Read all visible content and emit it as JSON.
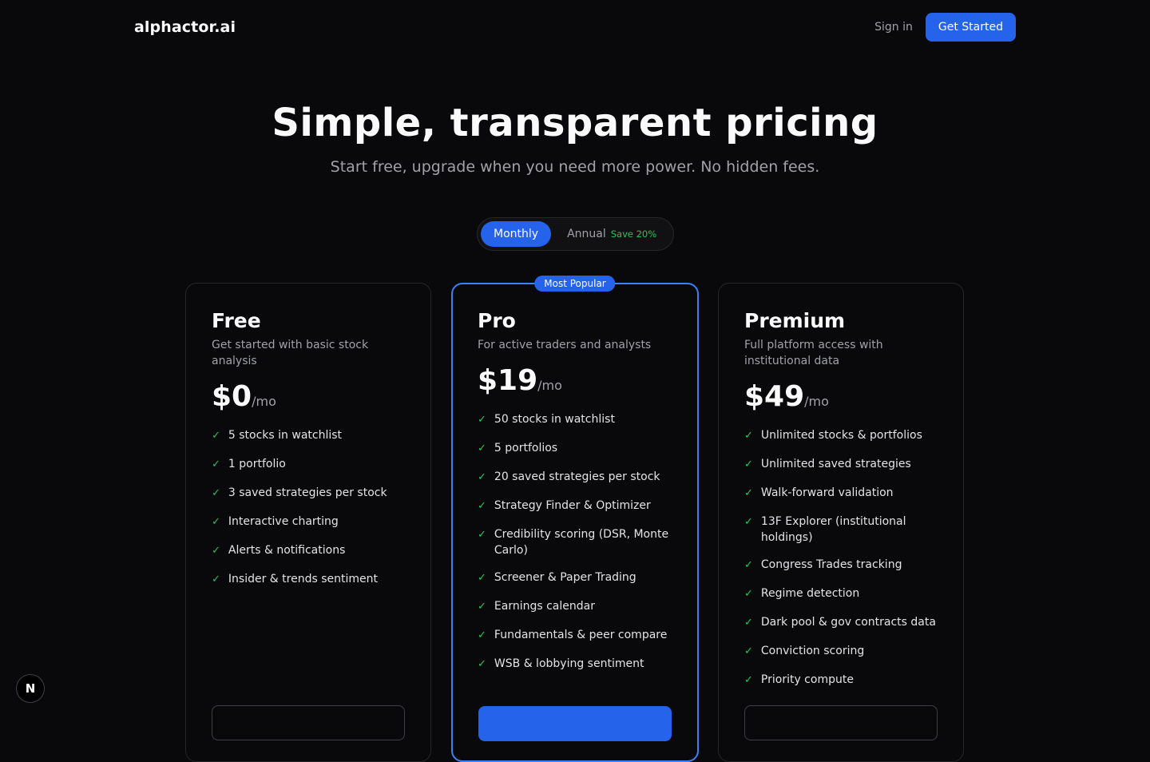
{
  "nav": {
    "logo": "alphactor.ai",
    "signin": "Sign in",
    "get_started": "Get Started"
  },
  "hero": {
    "title": "Simple, transparent pricing",
    "subtitle": "Start free, upgrade when you need more power. No hidden fees."
  },
  "billing_toggle": {
    "monthly": "Monthly",
    "annual": "Annual",
    "save": "Save 20%",
    "selected": "Monthly"
  },
  "plans": [
    {
      "name": "Free",
      "description": "Get started with basic stock analysis",
      "price": "$0",
      "period": "/mo",
      "features": [
        "5 stocks in watchlist",
        "1 portfolio",
        "3 saved strategies per stock",
        "Interactive charting",
        "Alerts & notifications",
        "Insider & trends sentiment"
      ]
    },
    {
      "name": "Pro",
      "badge": "Most Popular",
      "description": "For active traders and analysts",
      "price": "$19",
      "period": "/mo",
      "features": [
        "50 stocks in watchlist",
        "5 portfolios",
        "20 saved strategies per stock",
        "Strategy Finder & Optimizer",
        "Credibility scoring (DSR, Monte Carlo)",
        "Screener & Paper Trading",
        "Earnings calendar",
        "Fundamentals & peer compare",
        "WSB & lobbying sentiment"
      ]
    },
    {
      "name": "Premium",
      "description": "Full platform access with institutional data",
      "price": "$49",
      "period": "/mo",
      "features": [
        "Unlimited stocks & portfolios",
        "Unlimited saved strategies",
        "Walk-forward validation",
        "13F Explorer (institutional holdings)",
        "Congress Trades tracking",
        "Regime detection",
        "Dark pool & gov contracts data",
        "Conviction scoring",
        "Priority compute"
      ]
    }
  ],
  "colors": {
    "background": "#09090b",
    "accent": "#2563eb",
    "check": "#22c55e"
  },
  "dev_badge": "N"
}
